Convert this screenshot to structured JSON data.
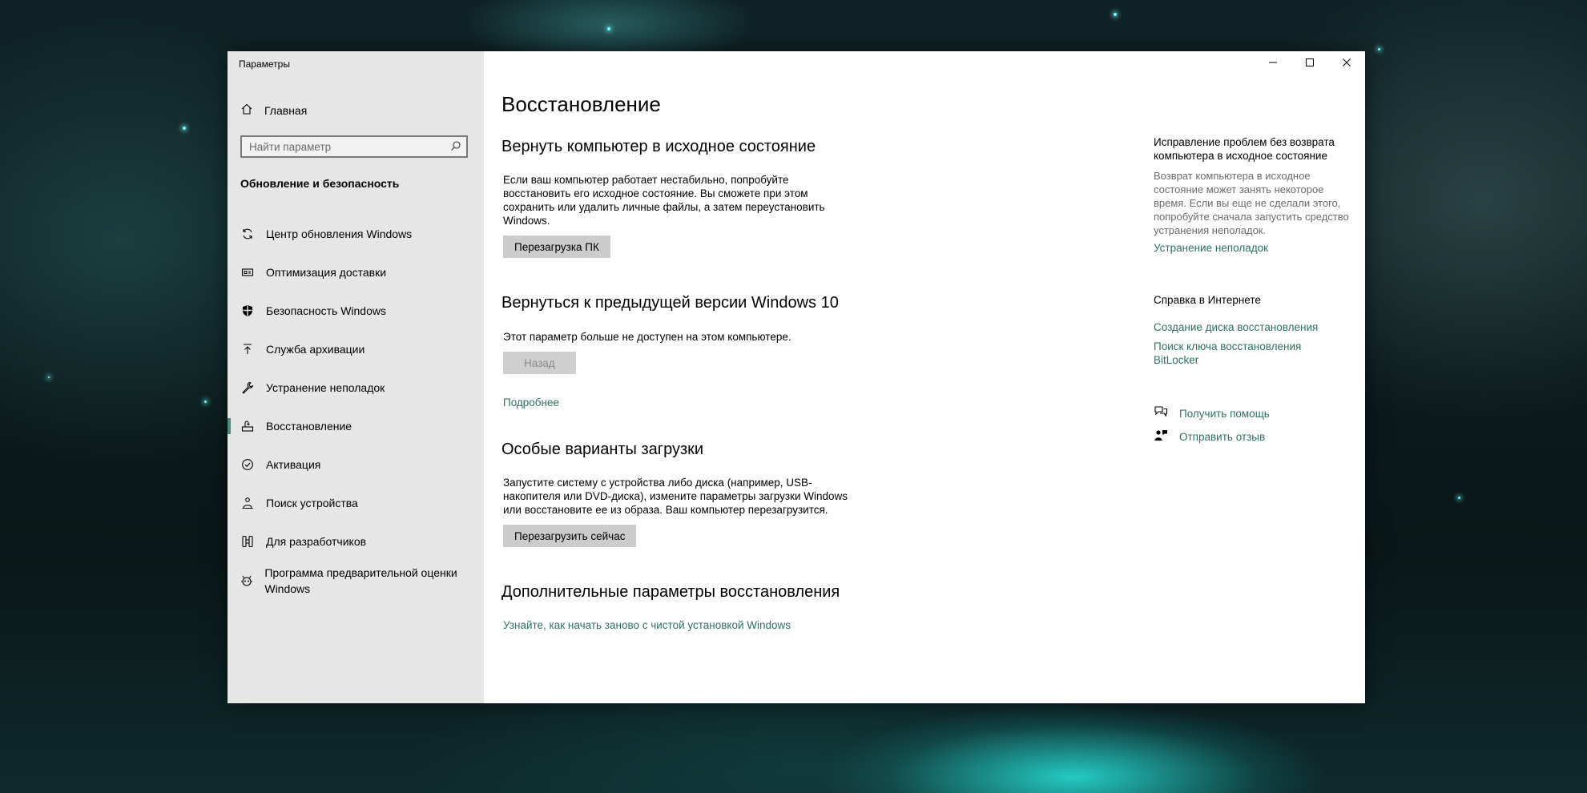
{
  "window": {
    "title": "Параметры"
  },
  "sidebar": {
    "home": "Главная",
    "search_placeholder": "Найти параметр",
    "section_title": "Обновление и безопасность",
    "items": [
      {
        "label": "Центр обновления Windows",
        "icon": "sync-icon"
      },
      {
        "label": "Оптимизация доставки",
        "icon": "delivery-icon"
      },
      {
        "label": "Безопасность Windows",
        "icon": "shield-icon"
      },
      {
        "label": "Служба архивации",
        "icon": "backup-arrow-icon"
      },
      {
        "label": "Устранение неполадок",
        "icon": "wrench-icon"
      },
      {
        "label": "Восстановление",
        "icon": "recovery-icon",
        "active": true
      },
      {
        "label": "Активация",
        "icon": "check-circle-icon"
      },
      {
        "label": "Поиск устройства",
        "icon": "person-pin-icon"
      },
      {
        "label": "Для разработчиков",
        "icon": "developer-icon"
      },
      {
        "label": "Программа предварительной оценки Windows",
        "icon": "insider-icon"
      }
    ]
  },
  "main": {
    "title": "Восстановление",
    "reset": {
      "heading": "Вернуть компьютер в исходное состояние",
      "text": "Если ваш компьютер работает нестабильно, попробуйте восстановить его исходное состояние. Вы сможете при этом сохранить или удалить личные файлы, а затем переустановить Windows.",
      "button": "Перезагрузка ПК"
    },
    "rollback": {
      "heading": "Вернуться к предыдущей версии Windows 10",
      "text": "Этот параметр больше не доступен на этом компьютере.",
      "button": "Назад",
      "link": "Подробнее"
    },
    "advanced_startup": {
      "heading": "Особые варианты загрузки",
      "text": "Запустите систему с устройства либо диска (например, USB-накопителя или DVD-диска), измените параметры загрузки Windows или восстановите ее из образа. Ваш компьютер перезагрузится.",
      "button": "Перезагрузить сейчас"
    },
    "more_options": {
      "heading": "Дополнительные параметры восстановления",
      "link": "Узнайте, как начать заново с чистой установкой Windows"
    }
  },
  "aside": {
    "fix_heading": "Исправление проблем без возврата компьютера в исходное состояние",
    "fix_text": "Возврат компьютера в исходное состояние может занять некоторое время. Если вы еще не сделали этого, попробуйте сначала запустить средство устранения неполадок.",
    "fix_link": "Устранение неполадок",
    "web_heading": "Справка в Интернете",
    "web_link_1": "Создание диска восстановления",
    "web_link_2": "Поиск ключа восстановления BitLocker",
    "get_help": "Получить помощь",
    "feedback": "Отправить отзыв"
  },
  "colors": {
    "accent": "#2f6f63",
    "sidebar_bg": "#e6e6e6",
    "button_bg": "#cccccc"
  }
}
